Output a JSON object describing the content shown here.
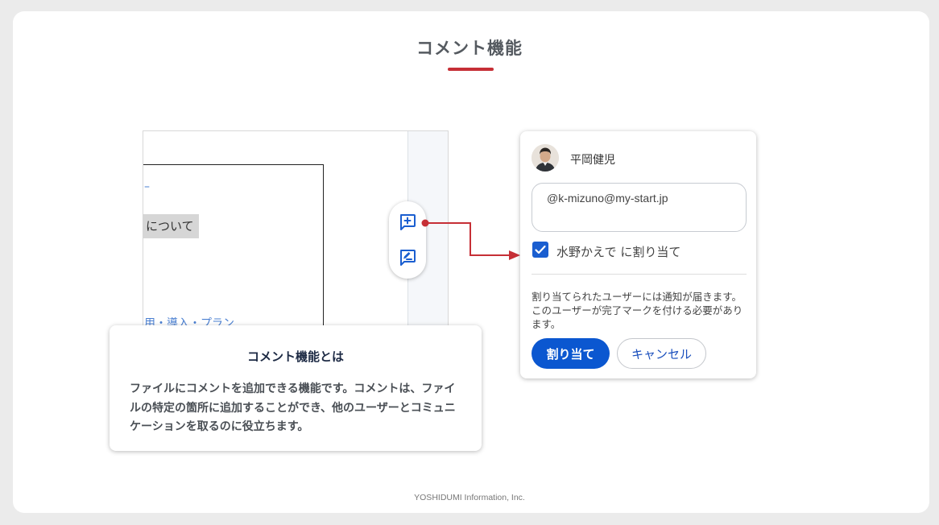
{
  "header": {
    "title": "コメント機能"
  },
  "document": {
    "dash_text": "–",
    "highlight_text": "について",
    "link_text": "用・導入・プラン"
  },
  "toolbar": {
    "add_comment_icon": "add-comment-icon",
    "suggest_edit_icon": "suggest-edit-icon"
  },
  "comment_panel": {
    "user_name": "平岡健児",
    "input_value": "@k-mizuno@my-start.jp",
    "assign_label": "水野かえで に割り当て",
    "assign_checked": true,
    "notice": "割り当てられたユーザーには通知が届きます。このユーザーが完了マークを付ける必要があります。",
    "assign_button": "割り当て",
    "cancel_button": "キャンセル"
  },
  "info_box": {
    "title": "コメント機能とは",
    "body": "ファイルにコメントを追加できる機能です。コメントは、ファイルの特定の箇所に追加することができ、他のユーザーとコミュニケーションを取るのに役立ちます。"
  },
  "footer": {
    "text": "YOSHIDUMI Information, Inc."
  },
  "colors": {
    "accent_red": "#c62f36",
    "primary_blue": "#0b57d0",
    "icon_blue": "#1a5ed0"
  }
}
